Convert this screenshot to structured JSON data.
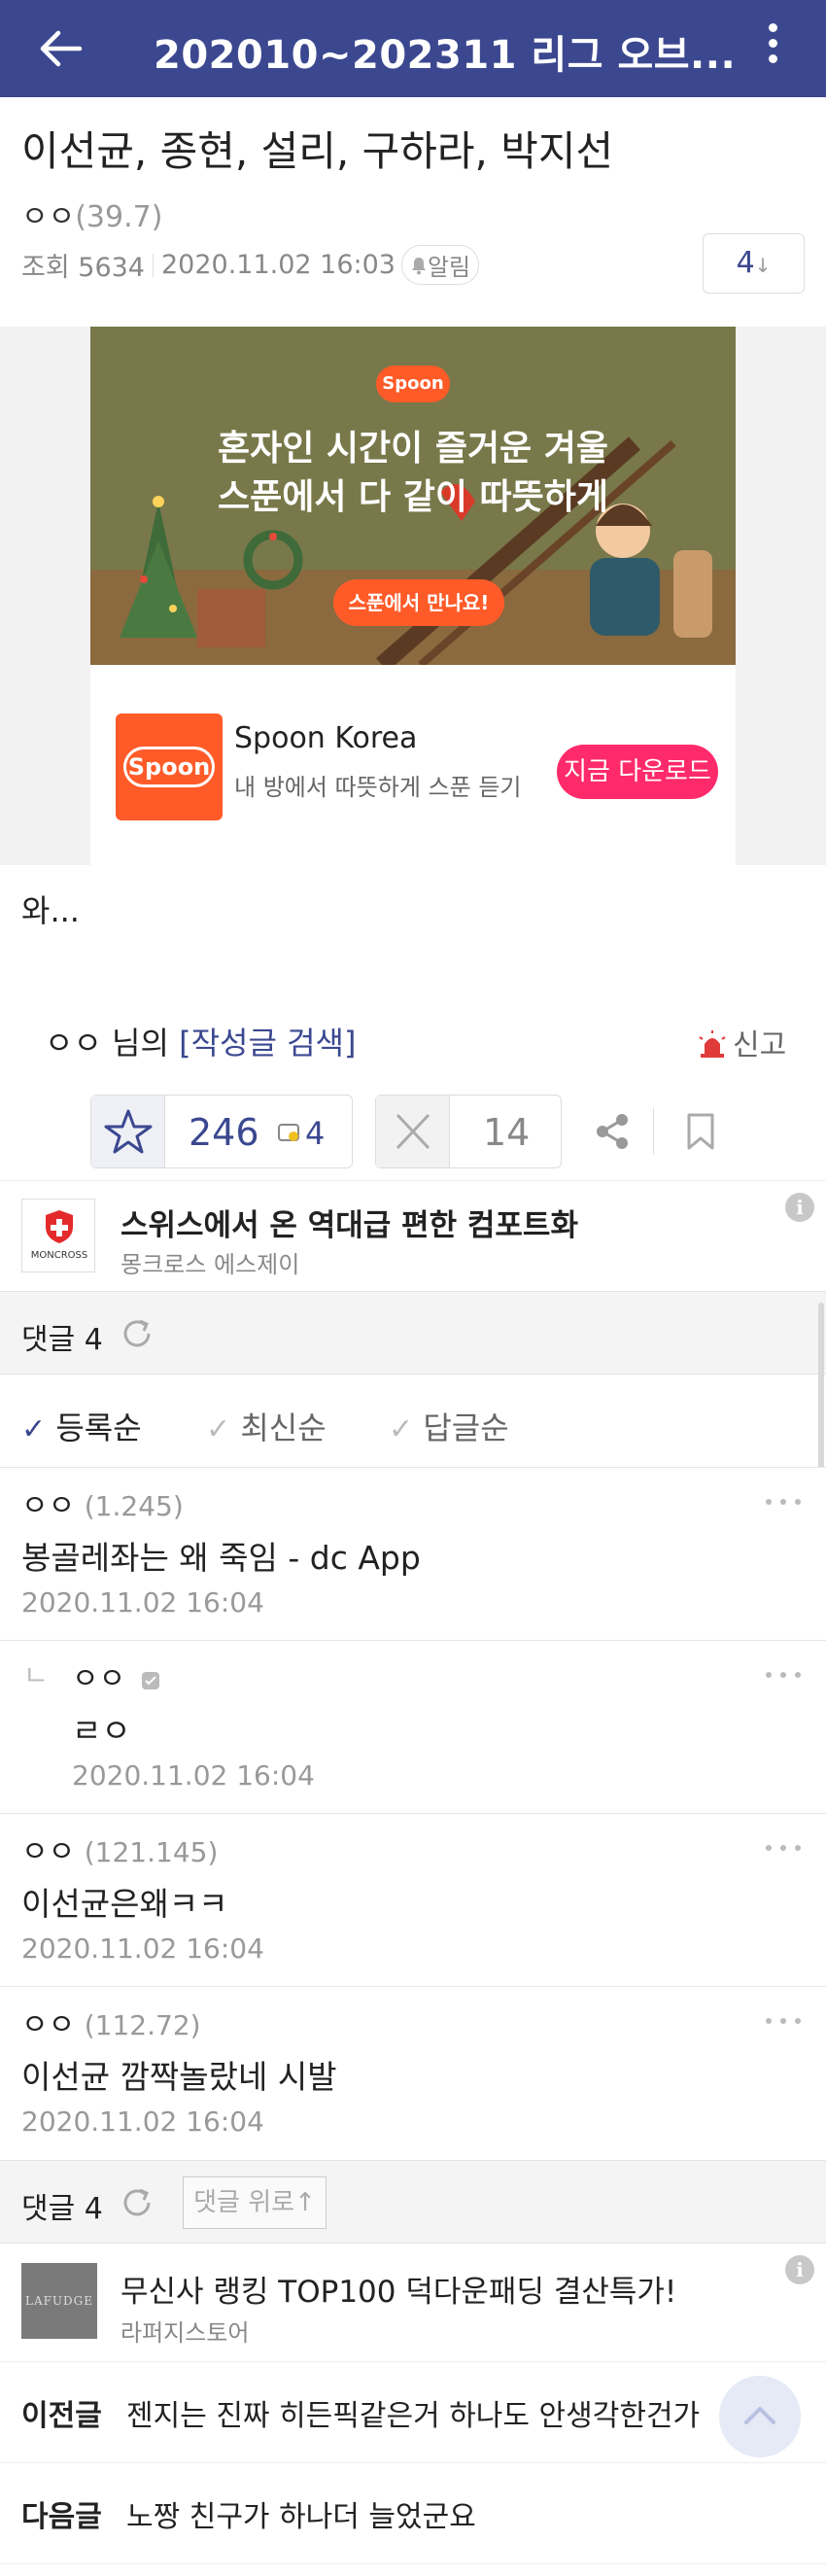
{
  "header": {
    "title": "202010~202311 리그 오브..."
  },
  "post": {
    "title": "이선균, 종현, 설리, 구하라, 박지선",
    "author": "ㅇㅇ",
    "author_sub": "(39.7)",
    "views": "조회 5634",
    "date": "2020.11.02 16:03",
    "alarm_label": "알림",
    "comment_count_box": "4",
    "body": "와..."
  },
  "ad_banner": {
    "brand_pill": "Spoon",
    "headline_1": "혼자인 시간이 즐거운 겨울",
    "headline_2": "스푼에서 다 같이 따뜻하게",
    "cta": "스푼에서 만나요!",
    "logo_text": "Spoon",
    "name": "Spoon Korea",
    "desc": "내 방에서 따뜻하게 스푼 듣기",
    "button": "지금 다운로드"
  },
  "author_search": {
    "prefix": "ㅇㅇ 님의 ",
    "link": "[작성글 검색]",
    "report": "신고"
  },
  "votes": {
    "up": "246",
    "gallery_up": "4",
    "down": "14"
  },
  "promo_1": {
    "logo_text": "MONCROSS",
    "title": "스위스에서 온 역대급 편한 컴포트화",
    "sub": "몽크로스 에스제이"
  },
  "comments_header": {
    "label": "댓글 4"
  },
  "sort": {
    "items": [
      "등록순",
      "최신순",
      "답글순"
    ]
  },
  "comments": [
    {
      "name": "ㅇㅇ",
      "pts": "(1.245)",
      "text": "봉골레좌는 왜 죽임 - dc App",
      "date": "2020.11.02 16:04"
    },
    {
      "name": "ㅇㅇ",
      "pts": "",
      "text": "ㄹㅇ",
      "date": "2020.11.02 16:04"
    },
    {
      "name": "ㅇㅇ",
      "pts": "(121.145)",
      "text": "이선균은왜ㅋㅋ",
      "date": "2020.11.02 16:04"
    },
    {
      "name": "ㅇㅇ",
      "pts": "(112.72)",
      "text": "이선균 깜짝놀랐네 시발",
      "date": "2020.11.02 16:04"
    }
  ],
  "bottom_bar": {
    "label": "댓글 4",
    "up_button": "댓글 위로↑"
  },
  "promo_2": {
    "logo_text": "LAFUDGE",
    "title": "무신사 랭킹 TOP100 덕다운패딩 결산특가!",
    "sub": "라퍼지스토어"
  },
  "nav": {
    "prev_label": "이전글",
    "prev_text": "젠지는 진짜 히든픽같은거 하나도 안생각한건가",
    "next_label": "다음글",
    "next_text": "노짱 친구가 하나더 늘었군요"
  },
  "colors": {
    "brand": "#3b4890",
    "spoon": "#ff5b29",
    "spoon_button": "#ff2a6a",
    "report_red": "#e03a3a"
  }
}
